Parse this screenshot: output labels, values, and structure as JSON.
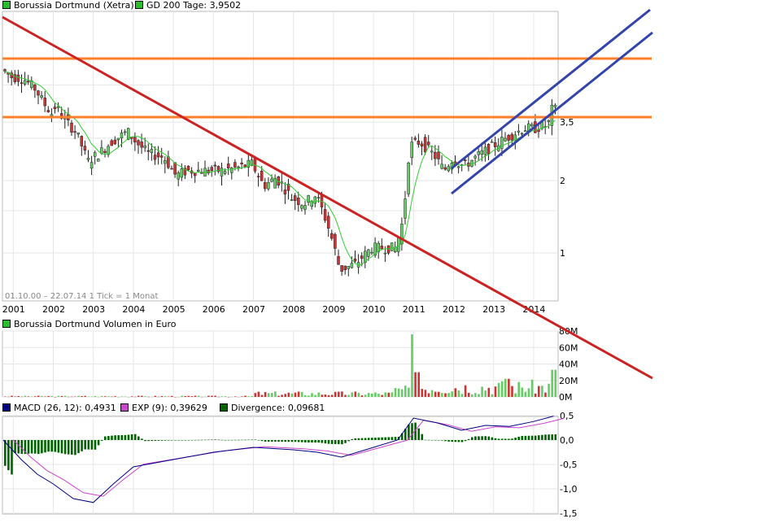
{
  "price_panel": {
    "legend": [
      {
        "label": "Borussia Dortmund (Xetra)",
        "color": "#2bbf2b"
      },
      {
        "label": "GD 200 Tage: 3,9502",
        "color": "#2bbf2b"
      }
    ],
    "period_text": "01.10.00 – 22.07.14   1 Tick = 1 Monat",
    "y_ticks": [
      {
        "value": 1,
        "label": "1"
      },
      {
        "value": 2,
        "label": "2"
      },
      {
        "value": 3.5,
        "label": "3,5"
      }
    ],
    "x_labels": [
      "2001",
      "2002",
      "2003",
      "2004",
      "2005",
      "2006",
      "2007",
      "2008",
      "2009",
      "2010",
      "2011",
      "2012",
      "2013",
      "2014"
    ]
  },
  "volume_panel": {
    "legend": [
      {
        "label": "Borussia Dortmund Volumen in Euro",
        "color": "#2bbf2b"
      }
    ],
    "y_ticks": [
      {
        "value": 0,
        "label": "0M"
      },
      {
        "value": 20,
        "label": "20M"
      },
      {
        "value": 40,
        "label": "40M"
      },
      {
        "value": 60,
        "label": "60M"
      },
      {
        "value": 80,
        "label": "80M"
      }
    ]
  },
  "macd_panel": {
    "legend": [
      {
        "label": "MACD (26, 12): 0,4931",
        "color": "#000080"
      },
      {
        "label": "EXP (9): 0,39629",
        "color": "#cc44cc"
      },
      {
        "label": "Divergence: 0,09681",
        "color": "#006400"
      }
    ],
    "y_ticks": [
      {
        "value": 0.5,
        "label": "0,5"
      },
      {
        "value": 0.0,
        "label": "0,0"
      },
      {
        "value": -0.5,
        "label": "-0,5"
      },
      {
        "value": -1.0,
        "label": "-1,0"
      },
      {
        "value": -1.5,
        "label": "-1,5"
      }
    ]
  },
  "colors": {
    "up": "#66cc66",
    "down": "#cc3333",
    "ma": "#33cc33",
    "trend_down": "#cc2222",
    "horizontal": "#ff7f2a",
    "channel": "#3344aa",
    "macd": "#000080",
    "exp": "#cc44cc",
    "divergence": "#006400",
    "grid": "#e6e6e6"
  },
  "chart_data": [
    {
      "type": "candlestick",
      "title": "Borussia Dortmund (Xetra)",
      "x": [
        "2001",
        "2002",
        "2003",
        "2004",
        "2005",
        "2006",
        "2007",
        "2008",
        "2009",
        "2010",
        "2011",
        "2012",
        "2013",
        "2014"
      ],
      "close": [
        5.6,
        4.0,
        3.0,
        3.6,
        2.4,
        2.0,
        2.0,
        2.3,
        1.8,
        1.2,
        0.8,
        1.1,
        3.2,
        3.4,
        2.7,
        3.0,
        3.3,
        3.9
      ],
      "y_scale": "log",
      "ma_label": "GD 200 Tage: 3,9502",
      "horizontal_levels": [
        4.6,
        3.1
      ]
    },
    {
      "type": "bar",
      "title": "Borussia Dortmund Volumen in Euro",
      "ylim": [
        0,
        80
      ],
      "unit": "M"
    },
    {
      "type": "line",
      "series": [
        {
          "name": "MACD (26, 12)",
          "last": 0.4931
        },
        {
          "name": "EXP (9)",
          "last": 0.39629
        },
        {
          "name": "Divergence",
          "last": 0.09681
        }
      ],
      "ylim": [
        -1.5,
        0.5
      ]
    }
  ]
}
